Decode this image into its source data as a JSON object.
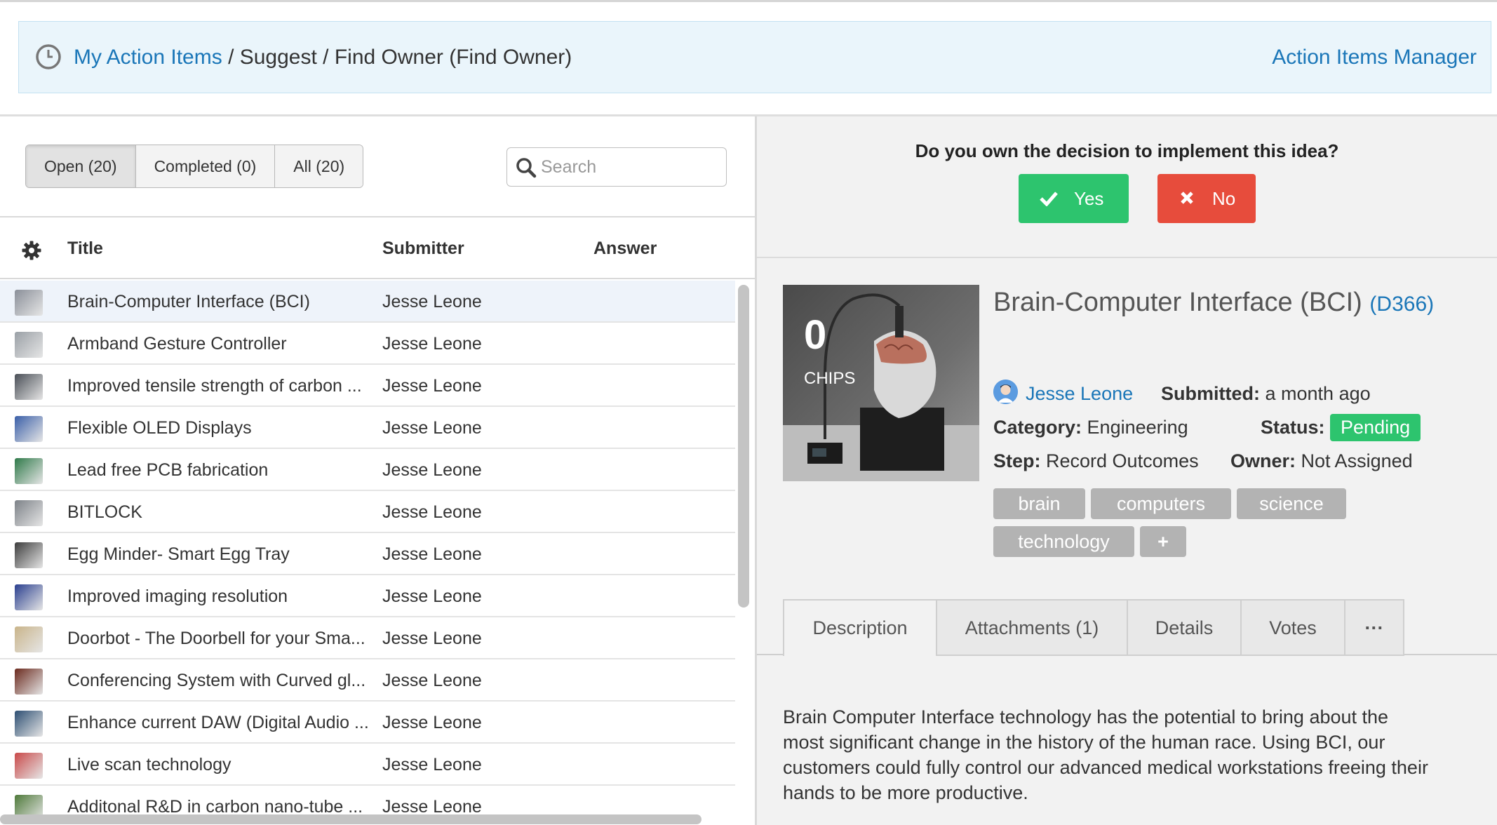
{
  "header": {
    "breadcrumb_link": "My Action Items",
    "breadcrumb_rest": " / Suggest / Find Owner (Find Owner)",
    "manager_link": "Action Items Manager"
  },
  "filters": {
    "open": "Open (20)",
    "completed": "Completed (0)",
    "all": "All (20)"
  },
  "search": {
    "placeholder": "Search"
  },
  "table": {
    "columns": {
      "title": "Title",
      "submitter": "Submitter",
      "answer": "Answer"
    },
    "rows": [
      {
        "title": "Brain-Computer Interface (BCI)",
        "submitter": "Jesse Leone",
        "color": "#8a8f99"
      },
      {
        "title": "Armband Gesture Controller",
        "submitter": "Jesse Leone",
        "color": "#9aa0a6"
      },
      {
        "title": "Improved tensile strength of carbon ...",
        "submitter": "Jesse Leone",
        "color": "#4a4f57"
      },
      {
        "title": "Flexible OLED Displays",
        "submitter": "Jesse Leone",
        "color": "#3a5fa8"
      },
      {
        "title": "Lead free PCB fabrication",
        "submitter": "Jesse Leone",
        "color": "#2f7a4a"
      },
      {
        "title": "BITLOCK",
        "submitter": "Jesse Leone",
        "color": "#7d8288"
      },
      {
        "title": "Egg Minder- Smart Egg Tray",
        "submitter": "Jesse Leone",
        "color": "#3d3d3d"
      },
      {
        "title": "Improved imaging resolution",
        "submitter": "Jesse Leone",
        "color": "#2a3f8f"
      },
      {
        "title": "Doorbot - The Doorbell for your Sma...",
        "submitter": "Jesse Leone",
        "color": "#c9b48a"
      },
      {
        "title": "Conferencing System with Curved gl...",
        "submitter": "Jesse Leone",
        "color": "#6b2a1e"
      },
      {
        "title": "Enhance current DAW (Digital Audio ...",
        "submitter": "Jesse Leone",
        "color": "#2d4f73"
      },
      {
        "title": "Live scan technology",
        "submitter": "Jesse Leone",
        "color": "#c94a4a"
      },
      {
        "title": "Additonal R&D in carbon nano-tube ...",
        "submitter": "Jesse Leone",
        "color": "#4f7a3a"
      }
    ]
  },
  "decision": {
    "question": "Do you own the decision to implement this idea?",
    "yes": "Yes",
    "no": "No"
  },
  "idea": {
    "chips_count": "0",
    "chips_label": "CHIPS",
    "title": "Brain-Computer Interface (BCI)",
    "code_open": "(",
    "code": "D366",
    "code_close": ")",
    "author": "Jesse Leone",
    "submitted_label": "Submitted:",
    "submitted_value": "a month ago",
    "category_label": "Category:",
    "category_value": "Engineering",
    "status_label": "Status:",
    "status_value": "Pending",
    "step_label": "Step:",
    "step_value": "Record Outcomes",
    "owner_label": "Owner:",
    "owner_value": "Not Assigned",
    "tags": [
      "brain",
      "computers",
      "science",
      "technology"
    ],
    "add_tag": "+"
  },
  "tabs": {
    "description": "Description",
    "attachments": "Attachments (1)",
    "details": "Details",
    "votes": "Votes",
    "more": "···"
  },
  "description": "Brain Computer Interface technology has the potential to bring about the most significant change in the history of the human race.  Using BCI, our customers could fully control our advanced medical workstations freeing their hands to be more productive.",
  "colors": {
    "link": "#1a76b8",
    "yes": "#2dc46e",
    "no": "#e74c3c",
    "status": "#2dc46e",
    "tag": "#b3b3b3"
  }
}
